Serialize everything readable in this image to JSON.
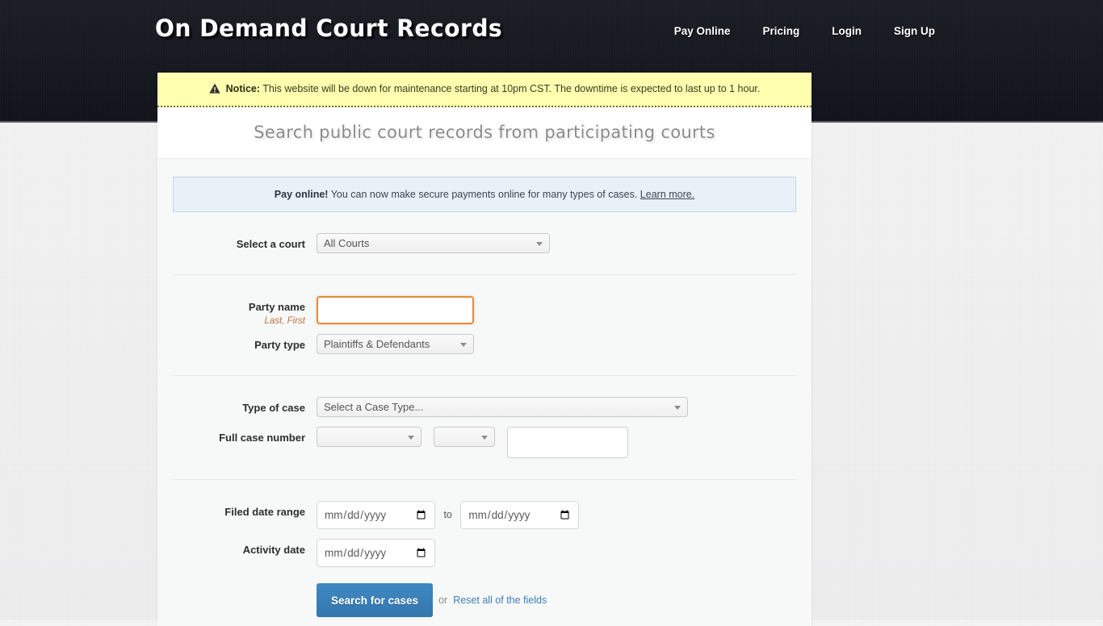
{
  "header": {
    "brand": "On Demand Court Records",
    "nav": [
      {
        "label": "Pay Online",
        "name": "nav-pay-online"
      },
      {
        "label": "Pricing",
        "name": "nav-pricing"
      },
      {
        "label": "Login",
        "name": "nav-login"
      },
      {
        "label": "Sign Up",
        "name": "nav-sign-up"
      }
    ]
  },
  "notice": {
    "icon": "warning-triangle-icon",
    "label": "Notice:",
    "message": " This website will be down for maintenance starting at 10pm CST. The downtime is expected to last up to 1 hour."
  },
  "page": {
    "heading": "Search public court records from participating courts"
  },
  "info_box": {
    "strong": "Pay online!",
    "text": " You can now make secure payments online for many types of cases. ",
    "link": "Learn more."
  },
  "form": {
    "court": {
      "label": "Select a court",
      "value": "All Courts",
      "options": [
        "All Courts"
      ]
    },
    "party_name": {
      "label": "Party name",
      "sublabel": "Last, First",
      "value": "",
      "placeholder": ""
    },
    "party_type": {
      "label": "Party type",
      "value": "Plaintiffs & Defendants",
      "options": [
        "Plaintiffs & Defendants"
      ]
    },
    "case_type": {
      "label": "Type of case",
      "value": "Select a Case Type...",
      "options": [
        "Select a Case Type..."
      ]
    },
    "case_number": {
      "label": "Full case number",
      "prefix_value": "",
      "middle_value": "",
      "number_value": "",
      "number_placeholder": ""
    },
    "filed_date": {
      "label": "Filed date range",
      "from_value": "",
      "to_value": "",
      "separator": "to",
      "placeholder": "mm/dd/yyyy"
    },
    "activity_date": {
      "label": "Activity date",
      "value": "",
      "placeholder": "mm/dd/yyyy"
    },
    "submit": {
      "button": "Search for cases",
      "or": "or",
      "reset": "Reset all of the fields"
    }
  },
  "colors": {
    "header_bg": "#14161d",
    "notice_bg": "#ffffaf",
    "info_bg": "#e8f1f8",
    "accent_blue": "#3a7fba",
    "focus_orange": "#e08c3e",
    "panel_bg": "#f7f8f8"
  }
}
